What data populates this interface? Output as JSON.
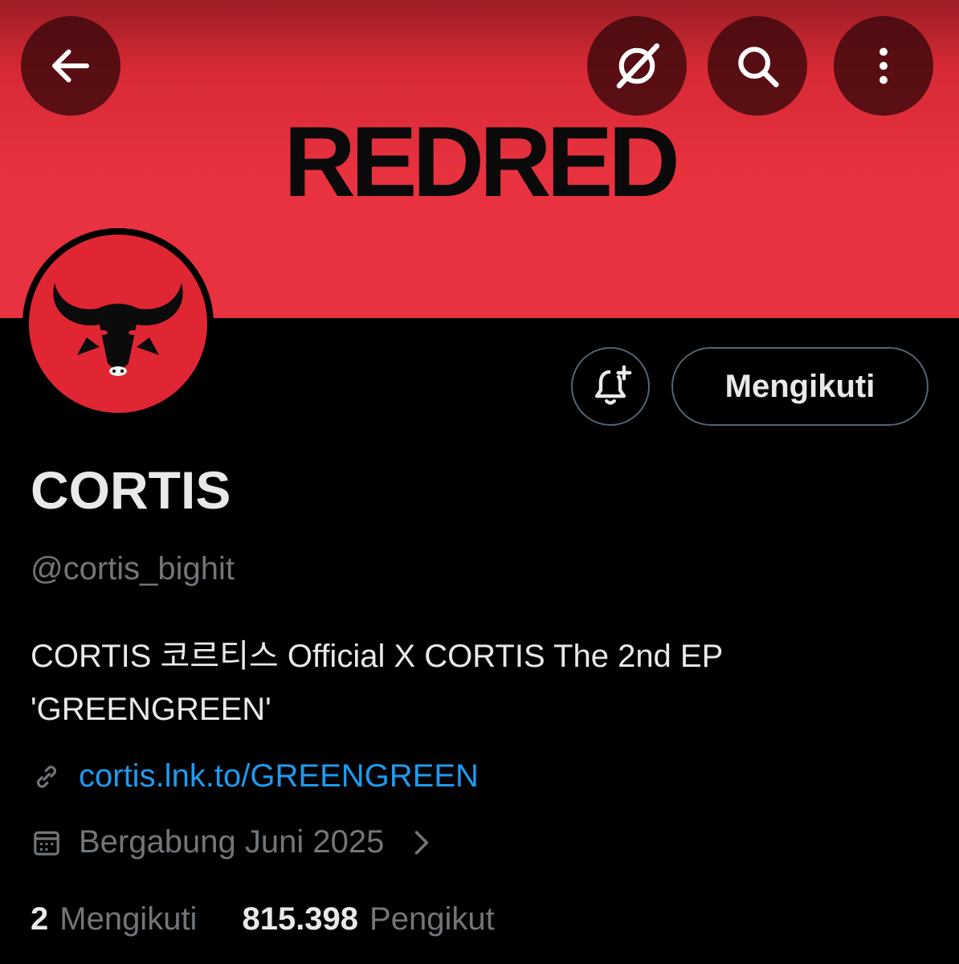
{
  "banner": {
    "text": "REDRED"
  },
  "header": {
    "back_icon": "arrow-left-icon",
    "grok_icon": "grok-icon",
    "search_icon": "search-icon",
    "more_icon": "more-vertical-icon"
  },
  "profile": {
    "avatar_icon": "bull-logo",
    "name": "CORTIS",
    "handle": "@cortis_bighit",
    "bio_line1": "CORTIS 코르티스 Official X CORTIS The 2nd EP",
    "bio_line2": "'GREENGREEN'",
    "link": "cortis.lnk.to/GREENGREEN",
    "joined": "Bergabung Juni 2025"
  },
  "actions": {
    "notify_icon": "bell-plus-icon",
    "follow_label": "Mengikuti"
  },
  "stats": {
    "following_count": "2",
    "following_label": "Mengikuti",
    "followers_count": "815.398",
    "followers_label": "Pengikut"
  },
  "colors": {
    "banner_red": "#e8323f",
    "link_blue": "#1d9bf0",
    "muted_gray": "#71767b",
    "background": "#000000"
  }
}
